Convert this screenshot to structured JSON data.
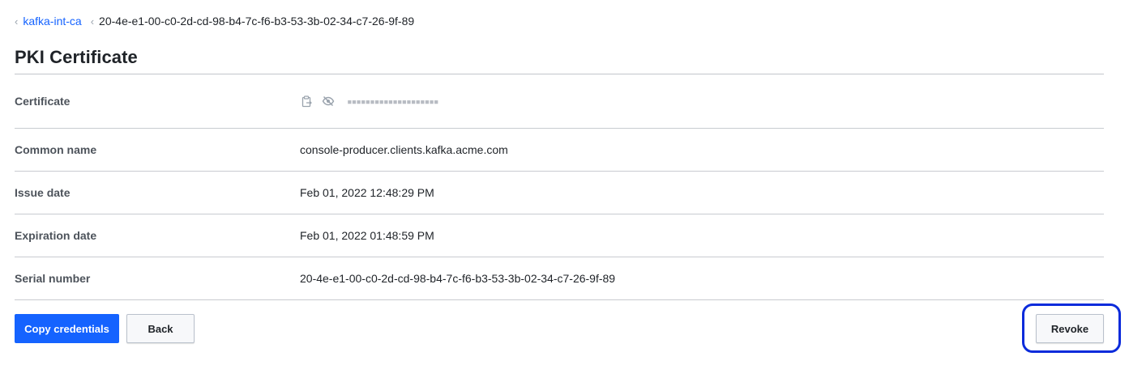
{
  "breadcrumb": {
    "parent": "kafka-int-ca",
    "current": "20-4e-e1-00-c0-2d-cd-98-b4-7c-f6-b3-53-3b-02-34-c7-26-9f-89"
  },
  "page_title": "PKI Certificate",
  "rows": [
    {
      "label": "Certificate",
      "value": "▪▪▪▪▪▪▪▪▪▪▪▪▪▪▪▪▪▪▪▪"
    },
    {
      "label": "Common name",
      "value": "console-producer.clients.kafka.acme.com"
    },
    {
      "label": "Issue date",
      "value": "Feb 01, 2022 12:48:29 PM"
    },
    {
      "label": "Expiration date",
      "value": "Feb 01, 2022 01:48:59 PM"
    },
    {
      "label": "Serial number",
      "value": "20-4e-e1-00-c0-2d-cd-98-b4-7c-f6-b3-53-3b-02-34-c7-26-9f-89"
    }
  ],
  "icons": {
    "copy": "clipboard-icon",
    "reveal": "eye-slash-icon",
    "breadcrumb_separator": "chevron-left-icon"
  },
  "actions": {
    "copy_credentials": "Copy credentials",
    "back": "Back",
    "revoke": "Revoke"
  },
  "colors": {
    "primary": "#1563ff",
    "highlight": "#0b2bdb",
    "label": "#4d535b",
    "divider": "#c8cbd0"
  }
}
